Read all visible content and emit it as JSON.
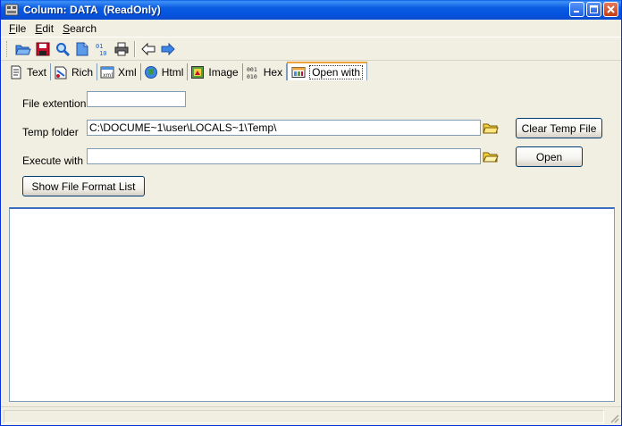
{
  "window": {
    "title": "Column: DATA  (ReadOnly)"
  },
  "menu": [
    {
      "label": "File",
      "accel": "F",
      "rest": "ile"
    },
    {
      "label": "Edit",
      "accel": "E",
      "rest": "dit"
    },
    {
      "label": "Search",
      "accel": "S",
      "rest": "earch"
    }
  ],
  "toolbar": {
    "icons": [
      "open-folder-icon",
      "save-icon",
      "find-icon",
      "document-icon",
      "binary-icon",
      "print-icon",
      "back-arrow-icon",
      "forward-arrow-icon"
    ]
  },
  "tabs": [
    {
      "label": "Text",
      "icon": "text-icon"
    },
    {
      "label": "Rich",
      "icon": "rich-text-icon"
    },
    {
      "label": "Xml",
      "icon": "xml-icon"
    },
    {
      "label": "Html",
      "icon": "html-globe-icon"
    },
    {
      "label": "Image",
      "icon": "image-icon"
    },
    {
      "label": "Hex",
      "icon": "hex-icon"
    },
    {
      "label": "Open with",
      "icon": "open-with-icon",
      "active": true
    }
  ],
  "form": {
    "file_extension_label": "File extention",
    "file_extension_value": "",
    "temp_folder_label": "Temp folder",
    "temp_folder_value": "C:\\DOCUME~1\\user\\LOCALS~1\\Temp\\",
    "execute_with_label": "Execute with",
    "execute_with_value": "",
    "clear_temp_button": "Clear Temp File",
    "open_button": "Open",
    "show_format_button": "Show File Format List"
  },
  "colors": {
    "titlebar": "#0554df",
    "active_tab_accent": "#f0a53c",
    "field_border": "#7f9db9",
    "window_bg": "#f1efe2"
  }
}
